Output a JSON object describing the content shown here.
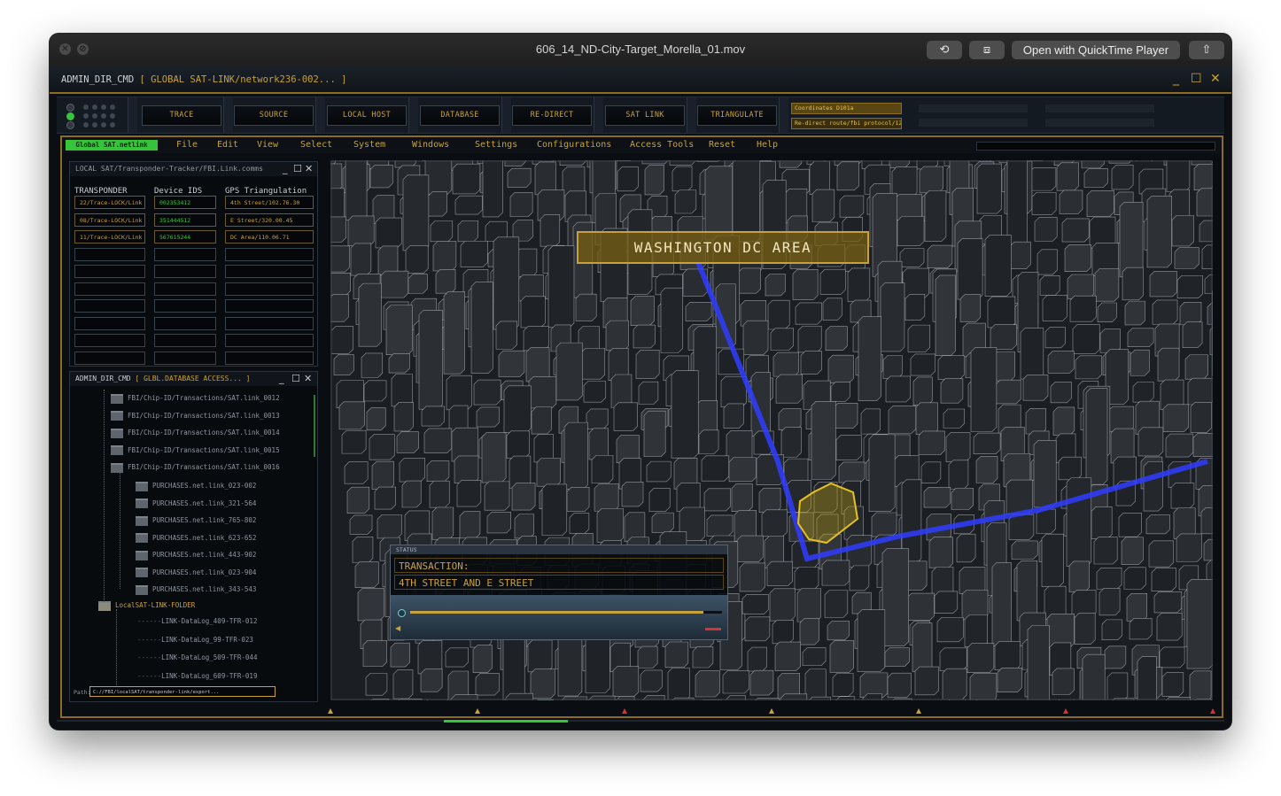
{
  "window": {
    "title": "606_14_ND-City-Target_Morella_01.mov",
    "open_button": "Open with QuickTime Player",
    "close_glyph": "✕",
    "minimize_glyph": "⊘",
    "rotate_glyph": "⟲",
    "trim_glyph": "⧈",
    "share_glyph": "⇧"
  },
  "admin": {
    "title_prefix": "ADMIN_DIR_CMD ",
    "title_suffix": "[ GLOBAL SAT-LINK/network236-002... ]",
    "min_glyph": "_",
    "max_glyph": "☐",
    "close_glyph": "✕"
  },
  "toolbar": {
    "buttons": [
      "TRACE",
      "SOURCE",
      "LOCAL HOST",
      "DATABASE",
      "RE-DIRECT",
      "SAT LINK",
      "TRIANGULATE"
    ],
    "coordinates": "Coordinates D101a",
    "redirect": "Re-direct route/fbi protocol/12..."
  },
  "menu": {
    "active": "Global SAT.netlink",
    "items": [
      "File",
      "Edit",
      "View",
      "Select",
      "System",
      "Windows",
      "Settings",
      "Configurations",
      "Access Tools",
      "Reset",
      "Help"
    ]
  },
  "transponder_panel": {
    "title": "LOCAL SAT/Transponder-Tracker/FBI.Link.comms",
    "headers": [
      "TRANSPONDER",
      "Device IDS",
      "GPS Triangulation"
    ],
    "rows": [
      [
        "22/Trace-LOCK/Link",
        "002353412",
        "4th Street/102.76.30"
      ],
      [
        "08/Trace-LOCK/Link",
        "351444512",
        "E Street/320.00.45"
      ],
      [
        "11/Trace-LOCK/Link",
        "567615244",
        "DC Area/110.06.71"
      ]
    ]
  },
  "database_panel": {
    "title_prefix": "ADMIN_DIR_CMD ",
    "title_suffix": "[ GLBL.DATABASE ACCESS... ]",
    "transactions": [
      "FBI/Chip-ID/Transactions/SAT.link_0012",
      "FBI/Chip-ID/Transactions/SAT.link_0013",
      "FBI/Chip-ID/Transactions/SAT.link_0014",
      "FBI/Chip-ID/Transactions/SAT.link_0015",
      "FBI/Chip-ID/Transactions/SAT.link_0016"
    ],
    "purchases": [
      "PURCHASES.net.link_023-002",
      "PURCHASES.net.link_321-564",
      "PURCHASES.net.link_765-802",
      "PURCHASES.net.link_623-652",
      "PURCHASES.net.link_443-902",
      "PURCHASES.net.link_023-904",
      "PURCHASES.net.link_343-543"
    ],
    "folder": "LocalSAT-LINK-FOLDER",
    "logs": [
      "LINK-DataLog_409-TFR-012",
      "LINK-DataLog_99-TFR-023",
      "LINK-DataLog_509-TFR-044",
      "LINK-DataLog_609-TFR-019"
    ],
    "path_label": "Path:",
    "path_value": "C://FBI/localSAT/transponder-link/export..."
  },
  "map": {
    "label": "WASHINGTON DC AREA",
    "status_header": "STATUS",
    "status_line1": "TRANSACTION:",
    "status_line2": "4TH STREET AND E STREET",
    "progress": 0.94
  },
  "colors": {
    "gold": "#c9a13a",
    "green": "#36c43a",
    "route_blue": "#2f3dff",
    "target_yellow": "#e6c21f"
  }
}
